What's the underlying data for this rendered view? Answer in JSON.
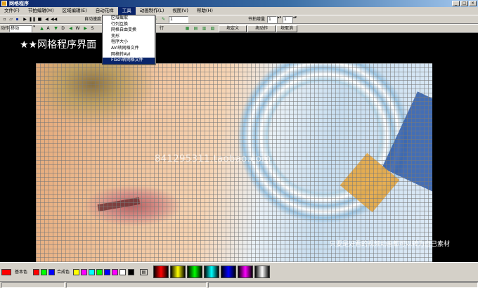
{
  "window": {
    "title": "网格程序"
  },
  "menubar": {
    "items": [
      {
        "label": "文件(F)"
      },
      {
        "label": "节拍编辑(M)"
      },
      {
        "label": "区域编辑(E)"
      },
      {
        "label": "自动花样"
      },
      {
        "label": "工具"
      },
      {
        "label": "动画制作(L)"
      },
      {
        "label": "视图(V)"
      },
      {
        "label": "帮助(H)"
      }
    ]
  },
  "tools_menu": {
    "items": [
      {
        "label": "区域截取"
      },
      {
        "label": "行列互换"
      },
      {
        "label": "网格自由变换"
      },
      {
        "label": "变形"
      },
      {
        "label": "程序大小"
      },
      {
        "label": "AVI转网格文件"
      },
      {
        "label": "网格转AVI"
      },
      {
        "label": "Flash转网格文件"
      }
    ],
    "highlighted": "Flash转网格文件"
  },
  "toolbar": {
    "auto_speed_label": "自动速度",
    "frame_value": "1",
    "beat_increment_label": "节拍增量",
    "beat_value_1": "1",
    "beat_value_2": "1",
    "action_label": "动作",
    "action_value": "移动",
    "row_label": "行",
    "buttons": {
      "a": "A",
      "d": "D",
      "w": "W",
      "s": "S"
    },
    "cmd1": "块定义",
    "cmd2": "块动作",
    "cmd3": "块取消"
  },
  "canvas": {
    "heading": "★★网格程序界面",
    "watermark": "841295311.taobao.com",
    "caption": "只要是好看的视频动画都可以转为自己素材"
  },
  "palette": {
    "base_label": "基本色",
    "composite_label": "合成色",
    "current_color": "#ff0000",
    "base_colors": [
      "#ff0000",
      "#00ff00",
      "#0000ff"
    ],
    "composite_colors": [
      "#ffff00",
      "#ff00ff",
      "#00ffff",
      "#00ff00",
      "#0000ff",
      "#ff00ff",
      "#ffffff",
      "#000000"
    ],
    "gradients": [
      [
        "#000000",
        "#ff0000"
      ],
      [
        "#000000",
        "#ffff00"
      ],
      [
        "#000000",
        "#00ff00"
      ],
      [
        "#000000",
        "#00ffff"
      ],
      [
        "#000000",
        "#0000ff"
      ],
      [
        "#000000",
        "#ff00ff"
      ],
      [
        "#000000",
        "#ffffff"
      ]
    ]
  }
}
